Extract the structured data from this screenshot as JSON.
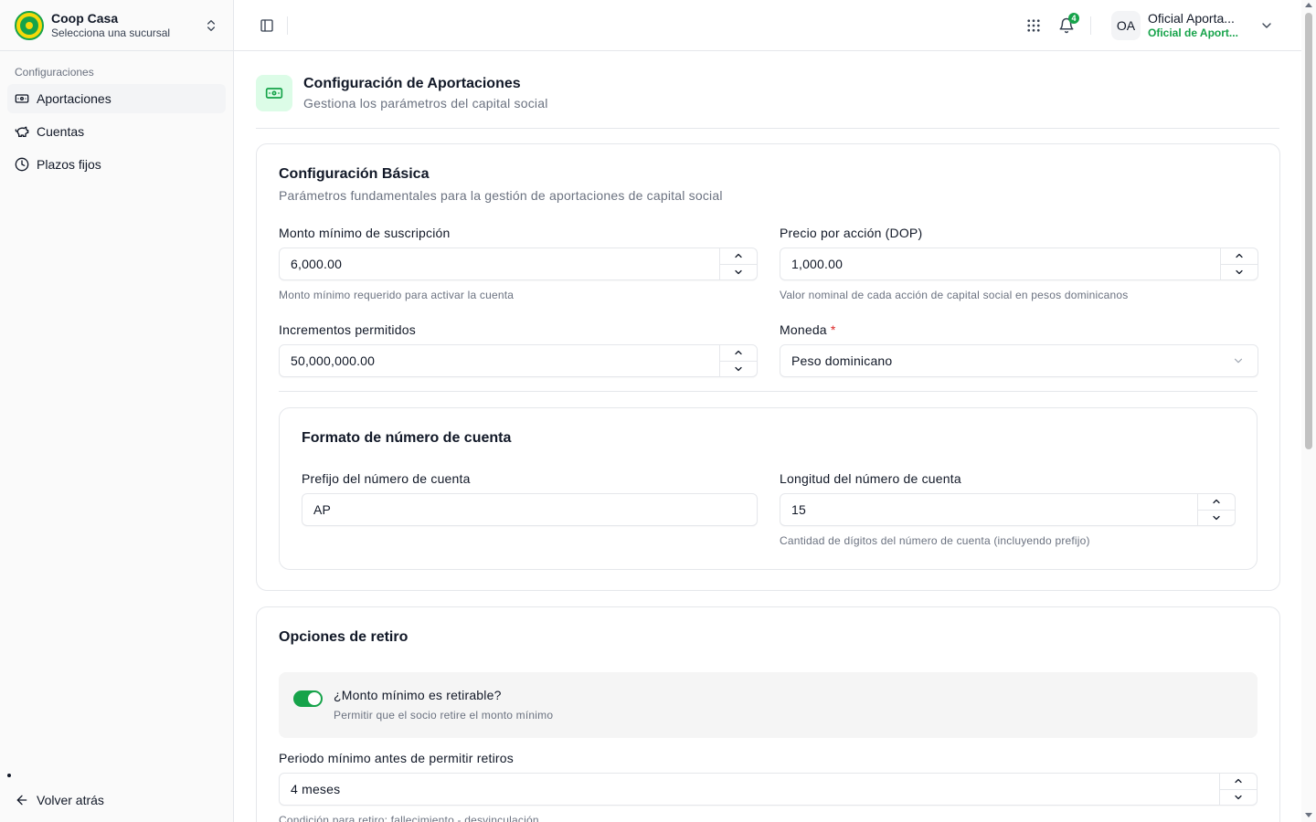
{
  "sidebar": {
    "org_name": "Coop Casa",
    "org_sub": "Selecciona una sucursal",
    "section_label": "Configuraciones",
    "items": [
      {
        "label": "Aportaciones",
        "icon": "banknote-icon",
        "active": true
      },
      {
        "label": "Cuentas",
        "icon": "piggy-bank-icon",
        "active": false
      },
      {
        "label": "Plazos fijos",
        "icon": "clock-icon",
        "active": false
      }
    ],
    "back_label": "Volver atrás"
  },
  "topbar": {
    "notification_count": "4",
    "avatar_initials": "OA",
    "user_name": "Oficial Aporta...",
    "user_role": "Oficial de Aport..."
  },
  "page": {
    "title": "Configuración de Aportaciones",
    "subtitle": "Gestiona los parámetros del capital social"
  },
  "basic": {
    "title": "Configuración Básica",
    "description": "Parámetros fundamentales para la gestión de aportaciones de capital social",
    "min_subscription": {
      "label": "Monto mínimo de suscripción",
      "value": "6,000.00",
      "hint": "Monto mínimo requerido para activar la cuenta"
    },
    "price_per_share": {
      "label": "Precio por acción (DOP)",
      "value": "1,000.00",
      "hint": "Valor nominal de cada acción de capital social en pesos dominicanos"
    },
    "increments": {
      "label": "Incrementos permitidos",
      "value": "50,000,000.00"
    },
    "currency": {
      "label": "Moneda",
      "required_mark": "*",
      "value": "Peso dominicano"
    }
  },
  "account_format": {
    "title": "Formato de número de cuenta",
    "prefix": {
      "label": "Prefijo del número de cuenta",
      "value": "AP"
    },
    "length": {
      "label": "Longitud del número de cuenta",
      "value": "15",
      "hint": "Cantidad de dígitos del número de cuenta (incluyendo prefijo)"
    }
  },
  "withdrawal": {
    "title": "Opciones de retiro",
    "toggle": {
      "label": "¿Monto mínimo es retirable?",
      "hint": "Permitir que el socio retire el monto mínimo",
      "checked": true
    },
    "min_period": {
      "label": "Periodo mínimo antes de permitir retiros",
      "value": "4 meses",
      "hint": "Condición para retiro: fallecimiento - desvinculación"
    }
  },
  "colors": {
    "accent": "#16a34a",
    "accent_light": "#dcfce7",
    "required": "#dc2626"
  }
}
